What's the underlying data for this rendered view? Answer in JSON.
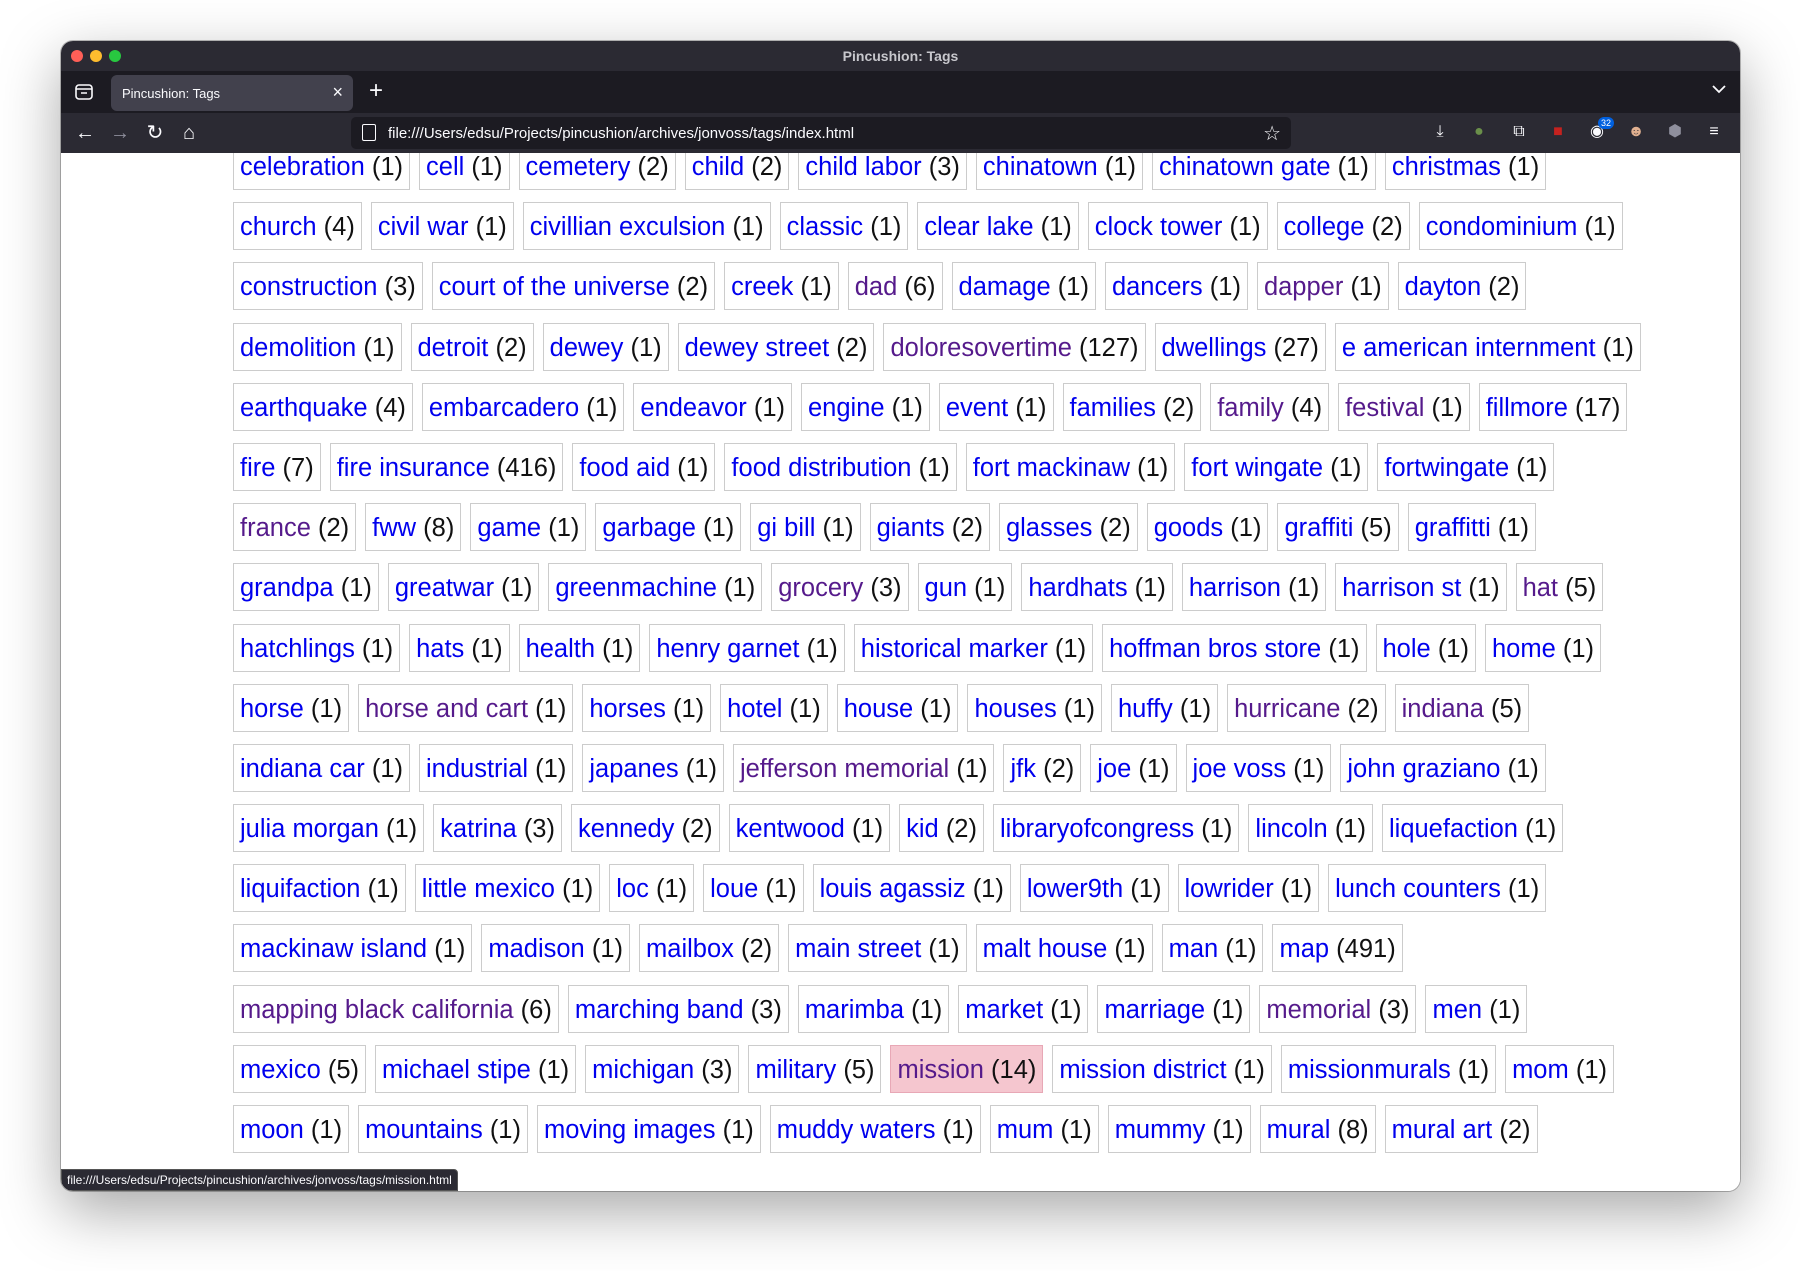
{
  "window": {
    "title": "Pincushion: Tags"
  },
  "tab": {
    "title": "Pincushion: Tags"
  },
  "navbar": {
    "url": "file:///Users/edsu/Projects/pincushion/archives/jonvoss/tags/index.html",
    "extensions_badge": "32"
  },
  "status_url": "file:///Users/edsu/Projects/pincushion/archives/jonvoss/tags/mission.html",
  "tag_rows": [
    [
      [
        "celebration",
        "(1)"
      ],
      [
        "cell",
        "(1)"
      ],
      [
        "cemetery",
        "(2)"
      ],
      [
        "child",
        "(2)"
      ],
      [
        "child labor",
        "(3)"
      ],
      [
        "chinatown",
        "(1)"
      ],
      [
        "chinatown gate",
        "(1)"
      ],
      [
        "christmas",
        "(1)"
      ]
    ],
    [
      [
        "church",
        "(4)"
      ],
      [
        "civil war",
        "(1)"
      ],
      [
        "civillian exculsion",
        "(1)"
      ],
      [
        "classic",
        "(1)"
      ],
      [
        "clear lake",
        "(1)"
      ],
      [
        "clock tower",
        "(1)"
      ],
      [
        "college",
        "(2)"
      ],
      [
        "condominium",
        "(1)"
      ]
    ],
    [
      [
        "construction",
        "(3)"
      ],
      [
        "court of the universe",
        "(2)"
      ],
      [
        "creek",
        "(1)"
      ],
      [
        "dad",
        "(6)"
      ],
      [
        "damage",
        "(1)"
      ],
      [
        "dancers",
        "(1)"
      ],
      [
        "dapper",
        "(1)"
      ],
      [
        "dayton",
        "(2)"
      ]
    ],
    [
      [
        "demolition",
        "(1)"
      ],
      [
        "detroit",
        "(2)"
      ],
      [
        "dewey",
        "(1)"
      ],
      [
        "dewey street",
        "(2)"
      ],
      [
        "doloresovertime",
        "(127)"
      ],
      [
        "dwellings",
        "(27)"
      ],
      [
        "e american internment",
        "(1)"
      ]
    ],
    [
      [
        "earthquake",
        "(4)"
      ],
      [
        "embarcadero",
        "(1)"
      ],
      [
        "endeavor",
        "(1)"
      ],
      [
        "engine",
        "(1)"
      ],
      [
        "event",
        "(1)"
      ],
      [
        "families",
        "(2)"
      ],
      [
        "family",
        "(4)"
      ],
      [
        "festival",
        "(1)"
      ],
      [
        "fillmore",
        "(17)"
      ]
    ],
    [
      [
        "fire",
        "(7)"
      ],
      [
        "fire insurance",
        "(416)"
      ],
      [
        "food aid",
        "(1)"
      ],
      [
        "food distribution",
        "(1)"
      ],
      [
        "fort mackinaw",
        "(1)"
      ],
      [
        "fort wingate",
        "(1)"
      ],
      [
        "fortwingate",
        "(1)"
      ]
    ],
    [
      [
        "france",
        "(2)"
      ],
      [
        "fww",
        "(8)"
      ],
      [
        "game",
        "(1)"
      ],
      [
        "garbage",
        "(1)"
      ],
      [
        "gi bill",
        "(1)"
      ],
      [
        "giants",
        "(2)"
      ],
      [
        "glasses",
        "(2)"
      ],
      [
        "goods",
        "(1)"
      ],
      [
        "graffiti",
        "(5)"
      ],
      [
        "graffitti",
        "(1)"
      ]
    ],
    [
      [
        "grandpa",
        "(1)"
      ],
      [
        "greatwar",
        "(1)"
      ],
      [
        "greenmachine",
        "(1)"
      ],
      [
        "grocery",
        "(3)"
      ],
      [
        "gun",
        "(1)"
      ],
      [
        "hardhats",
        "(1)"
      ],
      [
        "harrison",
        "(1)"
      ],
      [
        "harrison st",
        "(1)"
      ],
      [
        "hat",
        "(5)"
      ]
    ],
    [
      [
        "hatchlings",
        "(1)"
      ],
      [
        "hats",
        "(1)"
      ],
      [
        "health",
        "(1)"
      ],
      [
        "henry garnet",
        "(1)"
      ],
      [
        "historical marker",
        "(1)"
      ],
      [
        "hoffman bros store",
        "(1)"
      ],
      [
        "hole",
        "(1)"
      ],
      [
        "home",
        "(1)"
      ]
    ],
    [
      [
        "horse",
        "(1)"
      ],
      [
        "horse and cart",
        "(1)"
      ],
      [
        "horses",
        "(1)"
      ],
      [
        "hotel",
        "(1)"
      ],
      [
        "house",
        "(1)"
      ],
      [
        "houses",
        "(1)"
      ],
      [
        "huffy",
        "(1)"
      ],
      [
        "hurricane",
        "(2)"
      ],
      [
        "indiana",
        "(5)"
      ]
    ],
    [
      [
        "indiana car",
        "(1)"
      ],
      [
        "industrial",
        "(1)"
      ],
      [
        "japanes",
        "(1)"
      ],
      [
        "jefferson memorial",
        "(1)"
      ],
      [
        "jfk",
        "(2)"
      ],
      [
        "joe",
        "(1)"
      ],
      [
        "joe voss",
        "(1)"
      ],
      [
        "john graziano",
        "(1)"
      ]
    ],
    [
      [
        "julia morgan",
        "(1)"
      ],
      [
        "katrina",
        "(3)"
      ],
      [
        "kennedy",
        "(2)"
      ],
      [
        "kentwood",
        "(1)"
      ],
      [
        "kid",
        "(2)"
      ],
      [
        "libraryofcongress",
        "(1)"
      ],
      [
        "lincoln",
        "(1)"
      ],
      [
        "liquefaction",
        "(1)"
      ]
    ],
    [
      [
        "liquifaction",
        "(1)"
      ],
      [
        "little mexico",
        "(1)"
      ],
      [
        "loc",
        "(1)"
      ],
      [
        "loue",
        "(1)"
      ],
      [
        "louis agassiz",
        "(1)"
      ],
      [
        "lower9th",
        "(1)"
      ],
      [
        "lowrider",
        "(1)"
      ],
      [
        "lunch counters",
        "(1)"
      ]
    ],
    [
      [
        "mackinaw island",
        "(1)"
      ],
      [
        "madison",
        "(1)"
      ],
      [
        "mailbox",
        "(2)"
      ],
      [
        "main street",
        "(1)"
      ],
      [
        "malt house",
        "(1)"
      ],
      [
        "man",
        "(1)"
      ],
      [
        "map",
        "(491)"
      ]
    ],
    [
      [
        "mapping black california",
        "(6)"
      ],
      [
        "marching band",
        "(3)"
      ],
      [
        "marimba",
        "(1)"
      ],
      [
        "market",
        "(1)"
      ],
      [
        "marriage",
        "(1)"
      ],
      [
        "memorial",
        "(3)"
      ],
      [
        "men",
        "(1)"
      ]
    ],
    [
      [
        "mexico",
        "(5)"
      ],
      [
        "michael stipe",
        "(1)"
      ],
      [
        "michigan",
        "(3)"
      ],
      [
        "military",
        "(5)"
      ],
      [
        "mission",
        "(14)"
      ],
      [
        "mission district",
        "(1)"
      ],
      [
        "missionmurals",
        "(1)"
      ],
      [
        "mom",
        "(1)"
      ]
    ],
    [
      [
        "moon",
        "(1)"
      ],
      [
        "mountains",
        "(1)"
      ],
      [
        "moving images",
        "(1)"
      ],
      [
        "muddy waters",
        "(1)"
      ],
      [
        "mum",
        "(1)"
      ],
      [
        "mummy",
        "(1)"
      ],
      [
        "mural",
        "(8)"
      ],
      [
        "mural art",
        "(2)"
      ]
    ]
  ],
  "visited_tags": [
    "dad",
    "dapper",
    "doloresovertime",
    "family",
    "festival",
    "france",
    "grocery",
    "hat",
    "horse and cart",
    "hurricane",
    "indiana",
    "jefferson memorial",
    "memorial",
    "mapping black california"
  ],
  "hovered_tag": "mission",
  "colors": {
    "link": "#0000ee",
    "visited": "#551a8b",
    "hover_bg": "#f5c6cf",
    "chrome_dark": "#2b2a33",
    "tabbar": "#1c1b22"
  }
}
